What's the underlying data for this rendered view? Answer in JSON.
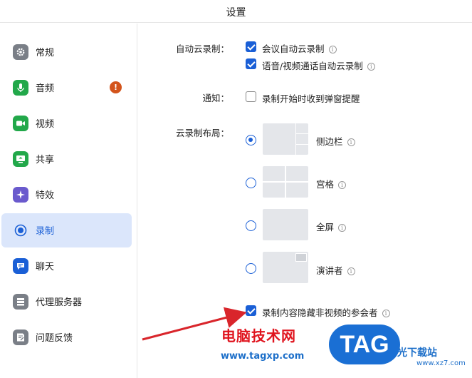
{
  "window": {
    "title": "设置"
  },
  "sidebar": {
    "items": [
      {
        "label": "常规",
        "icon": "gear-icon",
        "color": "#7a7f87"
      },
      {
        "label": "音频",
        "icon": "microphone-icon",
        "color": "#22a84a",
        "badge": "!"
      },
      {
        "label": "视频",
        "icon": "video-camera-icon",
        "color": "#22a84a"
      },
      {
        "label": "共享",
        "icon": "screen-share-icon",
        "color": "#22a84a"
      },
      {
        "label": "特效",
        "icon": "sparkle-icon",
        "color": "#6a5acd"
      },
      {
        "label": "录制",
        "icon": "record-icon",
        "color": "#1a5fd6",
        "selected": true
      },
      {
        "label": "聊天",
        "icon": "chat-icon",
        "color": "#1a5fd6"
      },
      {
        "label": "代理服务器",
        "icon": "server-icon",
        "color": "#7a7f87"
      },
      {
        "label": "问题反馈",
        "icon": "feedback-icon",
        "color": "#7a7f87"
      }
    ]
  },
  "recording": {
    "auto_cloud_label": "自动云录制：",
    "auto_cloud_meeting": {
      "label": "会议自动云录制",
      "checked": true
    },
    "auto_cloud_call": {
      "label": "语音/视频通话自动云录制",
      "checked": true
    },
    "notify_label": "通知：",
    "notify_popup": {
      "label": "录制开始时收到弹窗提醒",
      "checked": false
    },
    "layout_label": "云录制布局：",
    "layouts": [
      {
        "label": "侧边栏",
        "selected": true
      },
      {
        "label": "宫格",
        "selected": false
      },
      {
        "label": "全屏",
        "selected": false
      },
      {
        "label": "演讲者",
        "selected": false
      }
    ],
    "hide_nonvideo": {
      "label": "录制内容隐藏非视频的参会者",
      "checked": true
    }
  },
  "watermark": {
    "site_cn": "电脑技术网",
    "site_url": "www.tagxp.com",
    "logo_text": "TAG",
    "side_text": "光下载站",
    "side_url": "www.xz7.com"
  },
  "accent_color": "#1a5fd6"
}
